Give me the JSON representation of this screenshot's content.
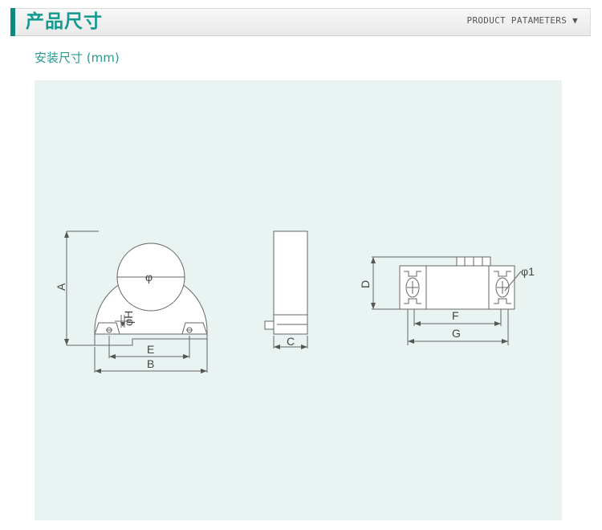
{
  "header": {
    "title": "产品尺寸",
    "subtitle": "PRODUCT  PATAMETERS",
    "dropdown_icon": "triangle-down-icon"
  },
  "section": {
    "title": "安装尺寸 (mm)"
  },
  "drawing": {
    "labels": {
      "a": "A",
      "b": "B",
      "c": "C",
      "d": "D",
      "e": "E",
      "f": "F",
      "g": "G",
      "h": "φH",
      "phi": "φ",
      "phi1": "φ1"
    }
  }
}
